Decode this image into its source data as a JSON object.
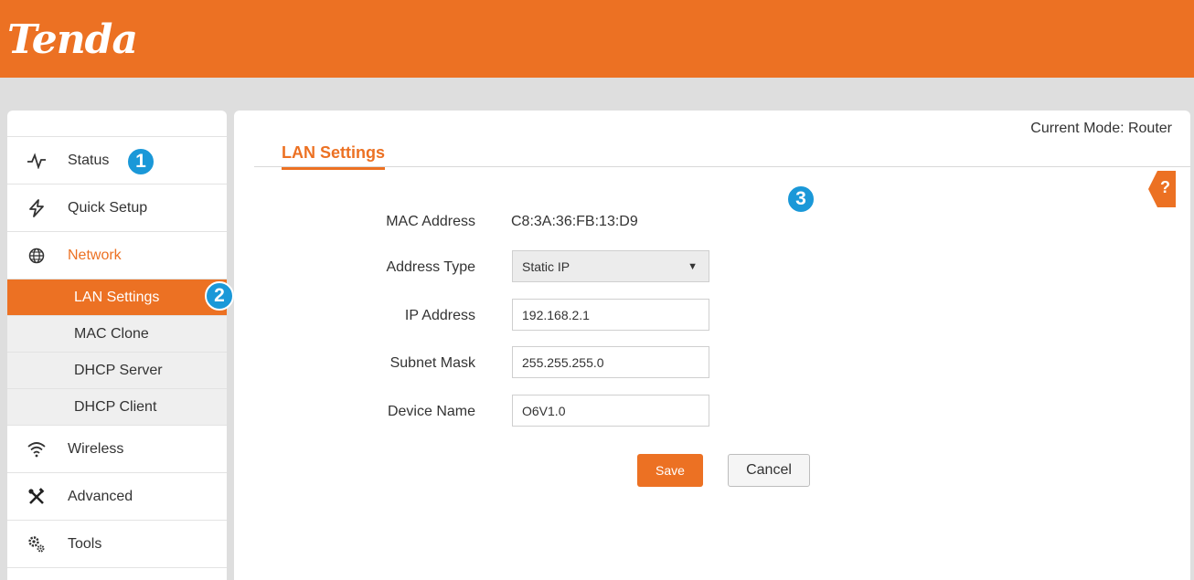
{
  "header": {
    "logo": "Tenda",
    "brand_color": "#ec7123"
  },
  "sidebar": {
    "items": [
      {
        "label": "Status",
        "icon": "pulse-icon"
      },
      {
        "label": "Quick Setup",
        "icon": "lightning-icon"
      },
      {
        "label": "Network",
        "icon": "globe-icon"
      },
      {
        "label": "Wireless",
        "icon": "wifi-icon"
      },
      {
        "label": "Advanced",
        "icon": "tools-icon"
      },
      {
        "label": "Tools",
        "icon": "gears-icon"
      }
    ],
    "network_sub": [
      "LAN Settings",
      "MAC Clone",
      "DHCP Server",
      "DHCP Client"
    ]
  },
  "callouts": [
    "1",
    "2",
    "3"
  ],
  "main": {
    "mode": "Current Mode: Router",
    "title": "LAN Settings",
    "help": "?",
    "form": {
      "mac_label": "MAC Address",
      "mac_value": "C8:3A:36:FB:13:D9",
      "type_label": "Address Type",
      "type_value": "Static IP",
      "ip_label": "IP Address",
      "ip_value": "192.168.2.1",
      "mask_label": "Subnet Mask",
      "mask_value": "255.255.255.0",
      "name_label": "Device Name",
      "name_value": "O6V1.0",
      "save_label": "Save",
      "cancel_label": "Cancel"
    }
  }
}
